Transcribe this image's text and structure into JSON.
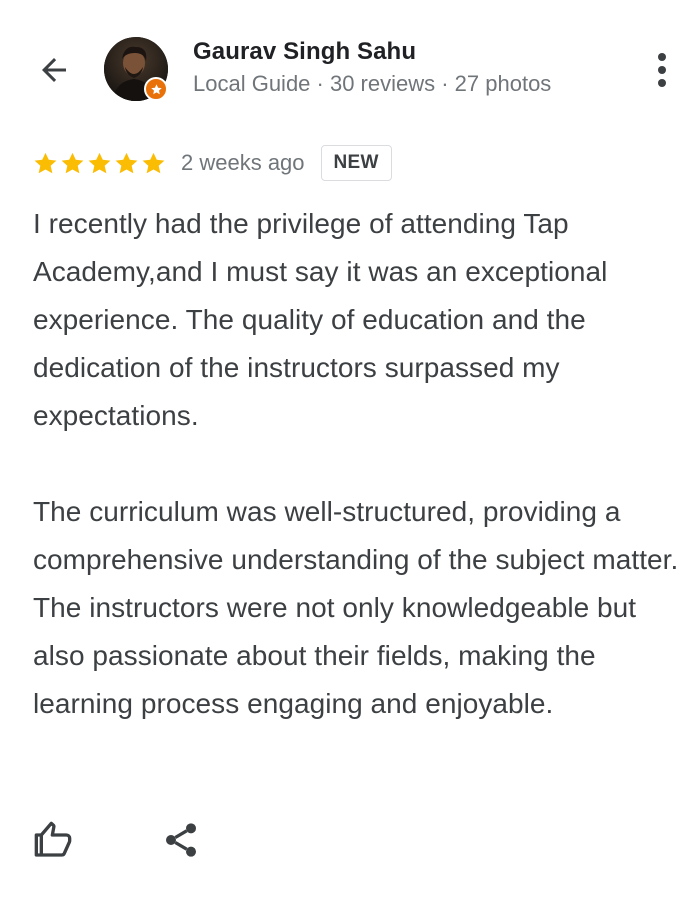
{
  "header": {
    "back_icon": "arrow-back-icon",
    "reviewer_name": "Gaurav Singh Sahu",
    "reviewer_meta": "Local Guide · 30 reviews · 27 photos",
    "local_guide_badge_icon": "star-badge-icon",
    "more_icon": "more-vert-icon"
  },
  "review": {
    "rating": 5,
    "rating_max": 5,
    "star_color": "#fbbc04",
    "time_ago": "2 weeks ago",
    "badge": "NEW",
    "paragraphs": [
      "I recently had the privilege of attending Tap Academy,and I must say it was an exceptional experience. The quality of education and the dedication of the instructors surpassed my expectations.",
      "The curriculum was well-structured, providing a comprehensive understanding of the subject matter. The instructors were not only knowledgeable but also passionate about their fields, making the learning process engaging and enjoyable."
    ]
  },
  "actions": {
    "like_icon": "thumbs-up-icon",
    "share_icon": "share-icon"
  },
  "colors": {
    "badge_orange": "#e8710a",
    "text_primary": "#202124",
    "text_secondary": "#70757a",
    "text_body": "#3c4043"
  }
}
